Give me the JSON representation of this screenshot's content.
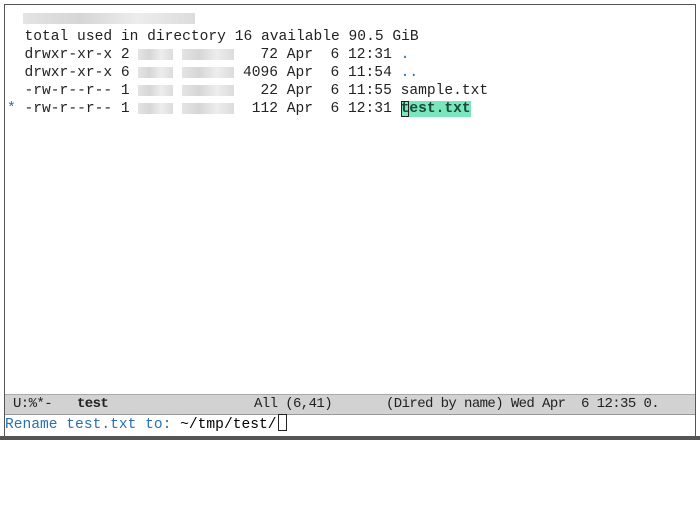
{
  "dired": {
    "summary": "total used in directory 16 available 90.5 GiB",
    "entries": [
      {
        "mark": " ",
        "perms": "drwxr-xr-x",
        "links": "2",
        "size": "  72",
        "date": "Apr  6 12:31",
        "name": ".",
        "is_dir": true
      },
      {
        "mark": " ",
        "perms": "drwxr-xr-x",
        "links": "6",
        "size": "4096",
        "date": "Apr  6 11:54",
        "name": "..",
        "is_dir": true
      },
      {
        "mark": " ",
        "perms": "-rw-r--r--",
        "links": "1",
        "size": "  22",
        "date": "Apr  6 11:55",
        "name": "sample.txt",
        "is_dir": false
      },
      {
        "mark": "*",
        "perms": "-rw-r--r--",
        "links": "1",
        "size": " 112",
        "date": "Apr  6 12:31",
        "name_first": "t",
        "name_rest": "est.txt",
        "is_dir": false
      }
    ]
  },
  "modeline": {
    "state": "U:%*-",
    "buffer": "test",
    "position": "All (6,41)",
    "mode": "(Dired by name) Wed Apr  6 12:35 0."
  },
  "minibuffer": {
    "prompt": "Rename test.txt to: ",
    "value": "~/tmp/test/"
  },
  "colors": {
    "highlight": "#79e6bd",
    "modeline_bg": "#d2d2d2",
    "prompt": "#2a6fb3"
  }
}
